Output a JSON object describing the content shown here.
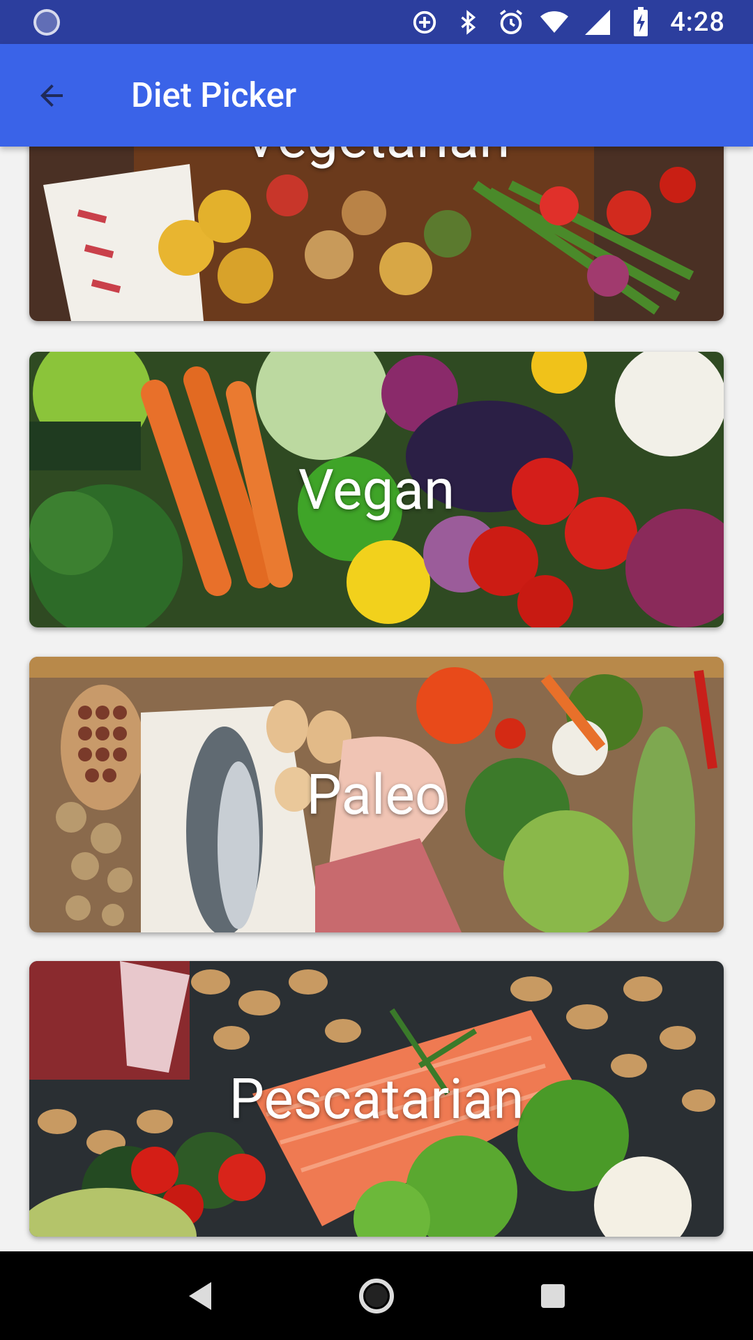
{
  "status_bar": {
    "time": "4:28",
    "icons": [
      "loading-spinner-icon",
      "data-saver-icon",
      "bluetooth-icon",
      "alarm-icon",
      "wifi-icon",
      "cell-signal-icon",
      "battery-charging-icon"
    ]
  },
  "app_bar": {
    "title": "Diet Picker",
    "back_icon": "arrow-back-icon"
  },
  "diets": [
    {
      "label": "Vegetarian",
      "image": "grilled vegetables on wooden board"
    },
    {
      "label": "Vegan",
      "image": "fresh vegetables assortment"
    },
    {
      "label": "Paleo",
      "image": "fish, eggs, meat and vegetables"
    },
    {
      "label": "Pescatarian",
      "image": "salmon, peanuts, greens and tomatoes"
    }
  ],
  "nav_bar": {
    "buttons": [
      "back-triangle-icon",
      "home-circle-icon",
      "recents-square-icon"
    ]
  },
  "colors": {
    "status_bar": "#2c3e9e",
    "app_bar": "#3a63e8",
    "background": "#f2f2f2"
  }
}
